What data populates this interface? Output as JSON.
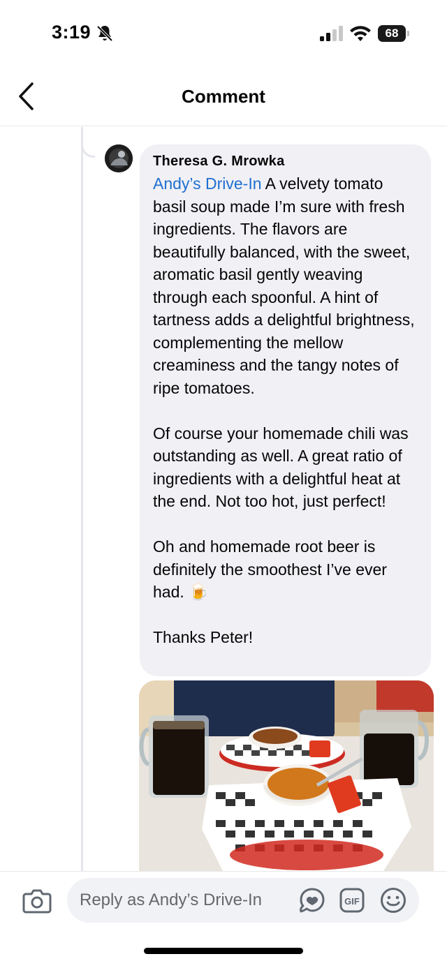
{
  "status_bar": {
    "time": "3:19",
    "battery_level": "68",
    "battery_fraction": 0.68,
    "icons": [
      "bell-slash-icon",
      "cellular-signal-icon",
      "wifi-icon",
      "battery-icon"
    ]
  },
  "header": {
    "title": "Comment",
    "back_icon": "chevron-left-icon"
  },
  "comment": {
    "author": "Theresa G. Mrowka",
    "mention": "Andy’s Drive-In",
    "body": " A velvety tomato basil soup made I’m sure with fresh ingredients. The flavors are beautifully balanced, with the sweet, aromatic basil gently weaving through each spoonful. A hint of tartness adds a delightful brightness, complementing the mellow creaminess and the tangy notes of ripe tomatoes.\n\nOf course your homemade chili was outstanding as well. A great ratio of ingredients with a delightful heat at the end. Not too hot, just perfect!\n\nOh and homemade root beer is definitely the smoothest I’ve ever had. 🍺\n\nThanks Peter!",
    "attachment": "photo-of-soup-chili-and-root-beer"
  },
  "reply_bar": {
    "placeholder": "Reply as Andy’s Drive-In",
    "icons": [
      "camera-icon",
      "avatar-sticker-icon",
      "gif-icon",
      "emoji-icon"
    ]
  },
  "colors": {
    "mention": "#1f6fd0",
    "bubble": "#f0f0f5",
    "reply_field": "#f0f2f5",
    "placeholder": "#65676b"
  }
}
